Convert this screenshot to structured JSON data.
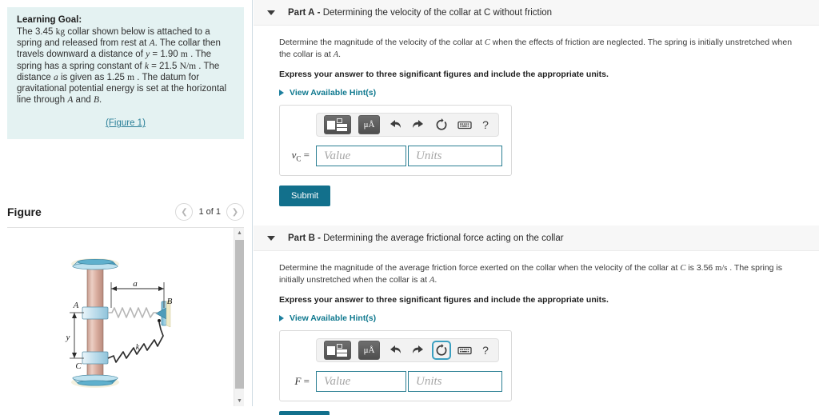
{
  "learning_goal": {
    "title": "Learning Goal:",
    "line1_a": "The 3.45",
    "line1_unit": "kg",
    "line1_b": "collar shown below is attached to a spring and released from rest at",
    "point_a": "A",
    "line2": ". The collar then travels downward a distance of",
    "var_y": "y",
    "eq_y": "= 1.90",
    "unit_m1": "m",
    "line3": ". The spring has a spring constant of",
    "var_k": "k",
    "eq_k": "= 21.5",
    "unit_k": "N/m",
    "line4": ". The distance",
    "var_a": "a",
    "eq_a": "is given as 1.25",
    "unit_m2": "m",
    "line5": ". The datum for gravitational potential energy is set at the horizontal line through",
    "point_a2": "A",
    "and": "and",
    "point_b": "B",
    "period": ".",
    "figure_link": "(Figure 1)"
  },
  "figure_panel": {
    "title": "Figure",
    "page_count": "1 of 1",
    "prev_icon": "chevron-left-icon",
    "next_icon": "chevron-right-icon",
    "diagram": {
      "label_a": "A",
      "label_b": "B",
      "label_c": "C",
      "label_y": "y",
      "label_a_dist": "a",
      "label_k": "k"
    }
  },
  "parts": [
    {
      "id": "a",
      "name": "Part A",
      "separator": "-",
      "title": "Determining the velocity of the collar at C without friction",
      "caret_icon": "caret-down-icon",
      "question_1": "Determine the magnitude of the velocity of the collar at",
      "question_var": "C",
      "question_2": "when the effects of friction are neglected. The spring is initially unstretched when the collar is at",
      "question_var2": "A",
      "question_3": ".",
      "instruction": "Express your answer to three significant figures and include the appropriate units.",
      "hint_label": "View Available Hint(s)",
      "answer_label": "v",
      "answer_sub": "C",
      "answer_eq": "=",
      "value_placeholder": "Value",
      "units_placeholder": "Units",
      "value": "",
      "units": "",
      "submit_label": "Submit"
    },
    {
      "id": "b",
      "name": "Part B",
      "separator": "-",
      "title": "Determining the average frictional force acting on the collar",
      "caret_icon": "caret-down-icon",
      "question_1": "Determine the magnitude of the average friction force exerted on the collar when the velocity of the collar at",
      "question_var": "C",
      "question_mid": "is 3.56",
      "question_unit": "m/s",
      "question_2": ". The spring is initially unstretched when the collar is at",
      "question_var2": "A",
      "question_3": ".",
      "instruction": "Express your answer to three significant figures and include the appropriate units.",
      "hint_label": "View Available Hint(s)",
      "answer_label": "F",
      "answer_sub": "",
      "answer_eq": "=",
      "value_placeholder": "Value",
      "units_placeholder": "Units",
      "value": "",
      "units": "",
      "submit_label": "Submit"
    }
  ],
  "toolbar": {
    "template_icon": "math-template-icon",
    "units_icon": "micro-angstrom-units-icon",
    "units_label": "μÅ",
    "undo_icon": "undo-arrow-icon",
    "redo_icon": "redo-arrow-icon",
    "reset_icon": "reset-circular-arrow-icon",
    "keyboard_icon": "keyboard-icon",
    "help_icon": "question-mark-icon",
    "help_label": "?"
  },
  "colors": {
    "accent_teal": "#12708c",
    "link_teal": "#10798f",
    "goal_bg": "#e4f2f2",
    "input_border": "#2b7f93",
    "header_bg": "#f7f7f7",
    "focus_ring": "#3a9fc0"
  }
}
